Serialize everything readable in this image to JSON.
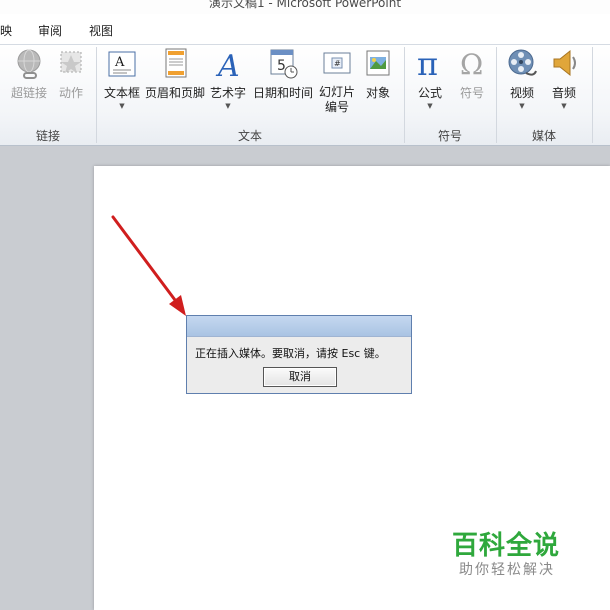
{
  "window": {
    "title": "演示文稿1 - Microsoft PowerPoint"
  },
  "menu": {
    "tabs": [
      "映",
      "审阅",
      "视图"
    ]
  },
  "ribbon": {
    "groups": [
      {
        "label": "链接",
        "buttons": [
          {
            "label": "超链接",
            "icon": "hyperlink-icon",
            "enabled": false
          },
          {
            "label": "动作",
            "icon": "action-icon",
            "enabled": false
          }
        ]
      },
      {
        "label": "文本",
        "buttons": [
          {
            "label": "文本框",
            "icon": "textbox-icon",
            "enabled": true
          },
          {
            "label": "页眉和页脚",
            "icon": "header-footer-icon",
            "enabled": true
          },
          {
            "label": "艺术字",
            "icon": "wordart-icon",
            "enabled": true
          },
          {
            "label": "日期和时间",
            "icon": "date-time-icon",
            "enabled": true
          },
          {
            "label": "幻灯片编号",
            "label_line1": "幻灯片",
            "label_line2": "编号",
            "icon": "slide-number-icon",
            "enabled": true
          },
          {
            "label": "对象",
            "icon": "object-icon",
            "enabled": true
          }
        ]
      },
      {
        "label": "符号",
        "buttons": [
          {
            "label": "公式",
            "icon": "pi-icon",
            "enabled": true
          },
          {
            "label": "符号",
            "icon": "omega-icon",
            "enabled": false
          }
        ]
      },
      {
        "label": "媒体",
        "buttons": [
          {
            "label": "视频",
            "icon": "film-reel-icon",
            "enabled": true
          },
          {
            "label": "音频",
            "icon": "speaker-icon",
            "enabled": true
          }
        ]
      }
    ]
  },
  "dialog": {
    "message": "正在插入媒体。要取消，请按 Esc 键。",
    "cancel_label": "取消"
  },
  "watermark": {
    "line1": "百科全说",
    "line2": "助你轻松解决"
  },
  "colors": {
    "arrow": "#d01e1e",
    "watermark_green": "#2fa83c",
    "dialog_title": "#b7cce8"
  }
}
